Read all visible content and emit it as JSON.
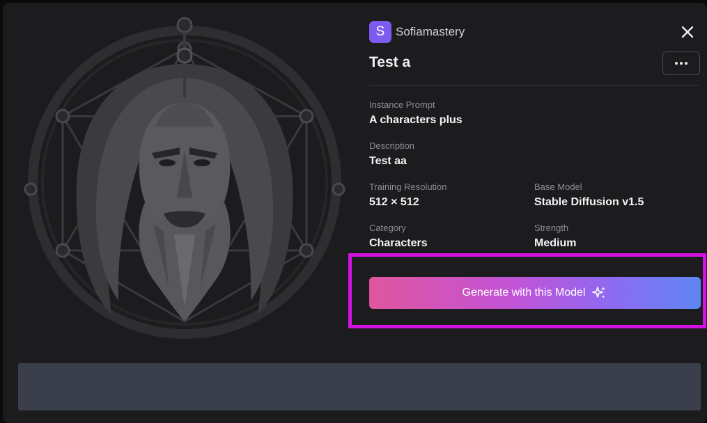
{
  "modal": {
    "user": {
      "avatar_letter": "S",
      "name": "Sofiamastery",
      "avatar_color": "#7c5cf0"
    },
    "title": "Test a",
    "fields": {
      "instance_prompt": {
        "label": "Instance Prompt",
        "value": "A characters plus"
      },
      "description": {
        "label": "Description",
        "value": "Test aa"
      },
      "training_resolution": {
        "label": "Training Resolution",
        "value": "512 × 512"
      },
      "base_model": {
        "label": "Base Model",
        "value": "Stable Diffusion v1.5"
      },
      "category": {
        "label": "Category",
        "value": "Characters"
      },
      "strength": {
        "label": "Strength",
        "value": "Medium"
      }
    },
    "generate_button": {
      "label": "Generate with this Model",
      "icon": "sparkles-icon",
      "gradient": [
        "#e0559e",
        "#c054d9",
        "#8a6cf2",
        "#5e86f3"
      ]
    },
    "icons": {
      "close": "close-icon",
      "more": "more-horizontal-icon"
    },
    "highlight_color": "#d314e0"
  }
}
